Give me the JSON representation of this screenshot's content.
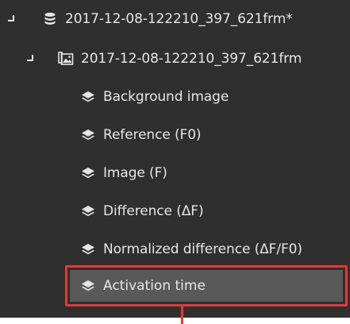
{
  "tree": {
    "root": {
      "label": "2017-12-08-122210_397_621frm*",
      "icon": "database-icon",
      "expanded": true
    },
    "group": {
      "label": "2017-12-08-122210_397_621frm",
      "icon": "image-stack-icon",
      "expanded": true
    },
    "layers": [
      {
        "label": "Background image",
        "icon": "layers-icon"
      },
      {
        "label": "Reference (F0)",
        "icon": "layers-icon"
      },
      {
        "label": "Image (F)",
        "icon": "layers-icon"
      },
      {
        "label": "Difference (ΔF)",
        "icon": "layers-icon"
      },
      {
        "label": "Normalized difference (ΔF/F0)",
        "icon": "layers-icon"
      },
      {
        "label": "Activation time",
        "icon": "layers-icon",
        "selected": true
      }
    ]
  },
  "colors": {
    "panel_background": "#2f2f2f",
    "text": "#e6e6e6",
    "selected_background": "#595959",
    "highlight": "#e53935"
  }
}
